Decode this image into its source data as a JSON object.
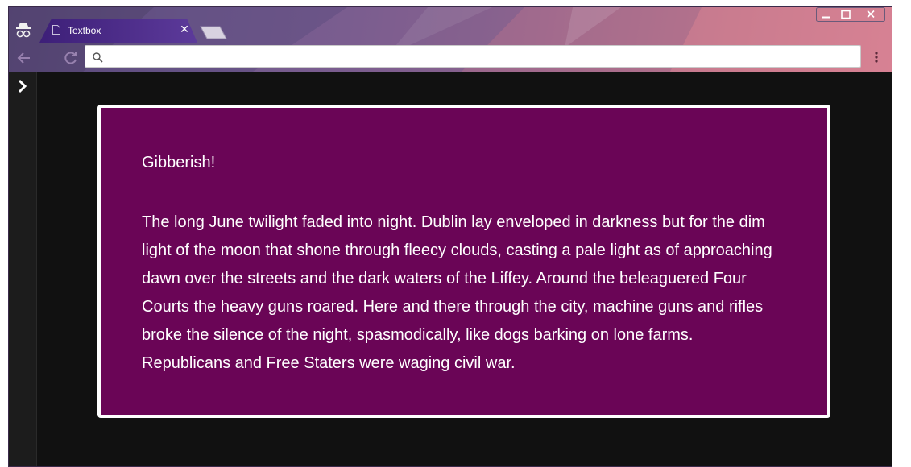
{
  "browser": {
    "tab": {
      "title": "Textbox"
    },
    "omnibox": {
      "value": "",
      "placeholder": ""
    },
    "icons": {
      "incognito": "incognito-icon",
      "tab_page": "page-icon",
      "tab_close": "close-icon",
      "new_tab": "new-tab-icon",
      "minimize": "minimize-icon",
      "maximize": "maximize-icon",
      "close": "close-window-icon",
      "back": "back-arrow-icon",
      "reload": "reload-icon",
      "search": "search-icon",
      "menu": "kebab-menu-icon",
      "sidebar_toggle": "chevron-right-icon"
    },
    "colors": {
      "frame_start": "#5a4a78",
      "frame_end": "#e58a96",
      "content_bg": "#111111"
    }
  },
  "page": {
    "heading": "Gibberish!",
    "body": "The long June twilight faded into night. Dublin lay enveloped in darkness but for the dim light of the moon that shone through fleecy clouds, casting a pale light as of approaching dawn over the streets and the dark waters of the Liffey. Around the beleaguered Four Courts the heavy guns roared. Here and there through the city, machine guns and rifles broke the silence of the night, spasmodically, like dogs barking on lone farms. Republicans and Free Staters were waging civil war.",
    "colors": {
      "card_bg": "#6a0556",
      "card_border": "#ffffff",
      "text": "#ffffff"
    }
  }
}
